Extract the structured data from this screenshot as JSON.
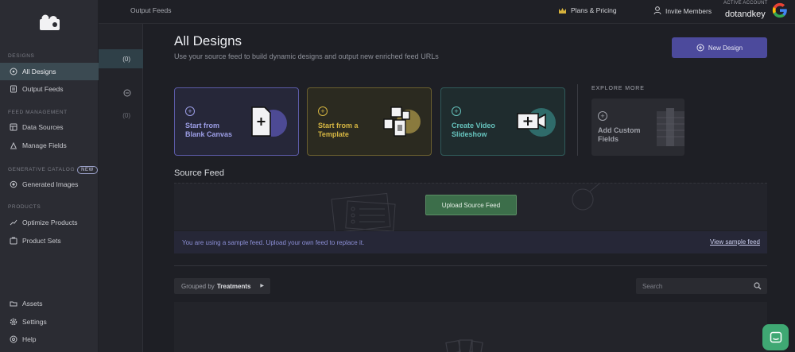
{
  "sidebar": {
    "sections": {
      "designs": "DESIGNS",
      "feed_management": "FEED MANAGEMENT",
      "generative_catalog": "GENERATIVE CATALOG",
      "generative_badge": "NEW",
      "products": "PRODUCTS"
    },
    "items": [
      {
        "label": "All Designs",
        "icon": "palette-icon"
      },
      {
        "label": "Output Feeds",
        "icon": "feed-icon"
      },
      {
        "label": "Data Sources",
        "icon": "database-icon"
      },
      {
        "label": "Manage Fields",
        "icon": "fields-icon"
      },
      {
        "label": "Generated Images",
        "icon": "image-gen-icon"
      },
      {
        "label": "Optimize Products",
        "icon": "trend-icon"
      },
      {
        "label": "Product Sets",
        "icon": "set-icon"
      },
      {
        "label": "Assets",
        "icon": "folder-icon"
      },
      {
        "label": "Settings",
        "icon": "gear-icon"
      },
      {
        "label": "Help",
        "icon": "help-icon"
      }
    ]
  },
  "secondary": {
    "counts": [
      "(0)",
      "(0)"
    ]
  },
  "topbar": {
    "breadcrumb": "Output Feeds",
    "plans": "Plans & Pricing",
    "invite": "Invite Members",
    "account_label": "ACTIVE ACCOUNT",
    "account_name": "dotandkey"
  },
  "main": {
    "title": "All Designs",
    "subtitle": "Use your source feed to build dynamic designs and output new enriched feed URLs",
    "new_design": "New Design",
    "cards": {
      "blank": [
        "Start from",
        "Blank Canvas"
      ],
      "template": [
        "Start from a",
        "Template"
      ],
      "slideshow": [
        "Create Video",
        "Slideshow"
      ]
    },
    "explore_label": "EXPLORE MORE",
    "custom_fields": [
      "Add Custom",
      "Fields"
    ],
    "source_feed_title": "Source Feed",
    "upload_button": "Upload Source Feed",
    "notice": "You are using a sample feed. Upload your own feed to replace it.",
    "view_sample": "View sample feed",
    "grouped_by_label": "Grouped by",
    "grouped_by_value": "Treatments",
    "search_placeholder": "Search"
  },
  "colors": {
    "accent": "#4c4a9c",
    "upload": "#3c6e4a",
    "active_nav": "#3b4a52",
    "chat": "#3fa873"
  }
}
